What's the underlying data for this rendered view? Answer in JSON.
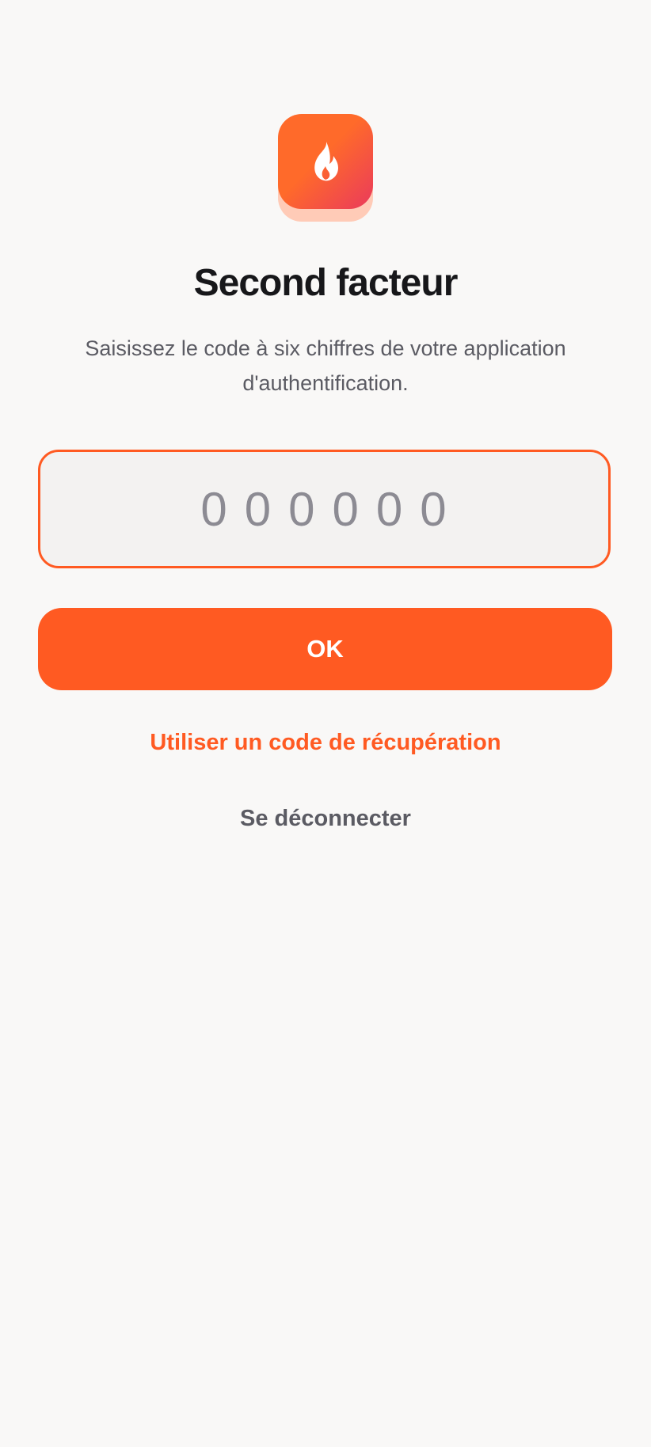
{
  "app": {
    "logo_icon": "flame-icon",
    "accent_color": "#ff5a22"
  },
  "header": {
    "title": "Second facteur",
    "subtitle": "Saisissez le code à six chiffres de votre application d'authentification."
  },
  "form": {
    "code_value": "",
    "code_placeholder": "000000",
    "submit_label": "OK"
  },
  "links": {
    "recovery_label": "Utiliser un code de récupération",
    "logout_label": "Se déconnecter"
  }
}
